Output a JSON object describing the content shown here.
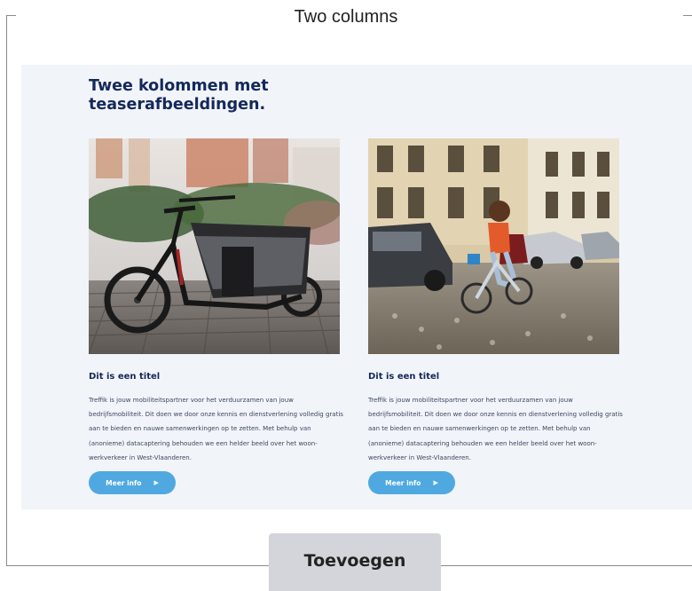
{
  "frame": {
    "title": "Two columns"
  },
  "preview": {
    "heading": "Twee kolommen met teaserafbeeldingen.",
    "columns": [
      {
        "image": "cargo-bike-photo",
        "title": "Dit is een titel",
        "text": "Treffik is jouw mobiliteitspartner voor het verduurzamen van jouw bedrijfsmobiliteit. Dit doen we door onze kennis en dienstverlening volledig gratis aan te bieden en nauwe samenwerkingen op te zetten. Met behulp van (anonieme) datacaptering behouden we een helder beeld over het woon-werkverkeer in West-Vlaanderen.",
        "button_label": "Meer info",
        "button_icon": "play-arrow-icon"
      },
      {
        "image": "woman-cycling-photo",
        "title": "Dit is een titel",
        "text": "Treffik is jouw mobiliteitspartner voor het verduurzamen van jouw bedrijfsmobiliteit. Dit doen we door onze kennis en dienstverlening volledig gratis aan te bieden en nauwe samenwerkingen op te zetten. Met behulp van (anonieme) datacaptering behouden we een helder beeld over het woon-werkverkeer in West-Vlaanderen.",
        "button_label": "Meer info",
        "button_icon": "play-arrow-icon"
      }
    ]
  },
  "add_button": {
    "label": "Toevoegen"
  },
  "colors": {
    "heading": "#14285a",
    "button": "#4fa9e0",
    "preview_bg": "#f1f4f9",
    "add_button_bg": "#d4d5da"
  }
}
